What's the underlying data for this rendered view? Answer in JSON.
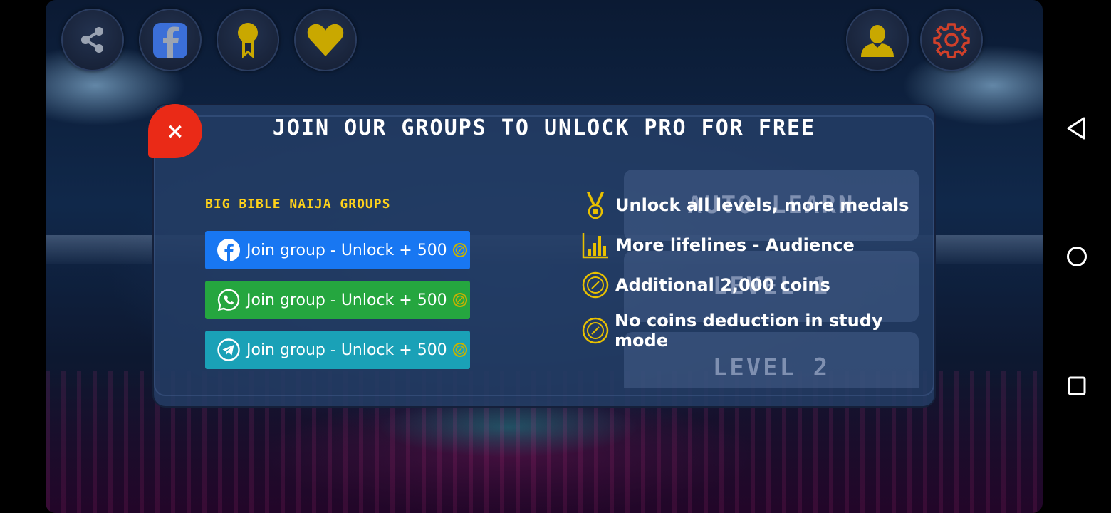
{
  "modal": {
    "title": "JOIN OUR GROUPS TO UNLOCK PRO FOR FREE",
    "close_label": "×",
    "groups_title": "BIG BIBLE NAIJA GROUPS",
    "buttons": [
      {
        "label": "Join group - Unlock + 500",
        "icon": "facebook-icon",
        "color": "#1877f2"
      },
      {
        "label": "Join group - Unlock + 500",
        "icon": "whatsapp-icon",
        "color": "#25a63f"
      },
      {
        "label": "Join group - Unlock + 500",
        "icon": "telegram-icon",
        "color": "#1aa1b7"
      }
    ],
    "features": [
      {
        "text": "Unlock all levels, more medals",
        "icon": "medal-icon"
      },
      {
        "text": "More lifelines - Audience",
        "icon": "bar-chart-icon"
      },
      {
        "text": "Additional 2,000 coins",
        "icon": "coin-icon"
      },
      {
        "text": "No coins deduction in study mode",
        "icon": "coin-icon"
      }
    ]
  },
  "background_levels": [
    "AUTO LEARN",
    "LEVEL 1",
    "LEVEL 2"
  ],
  "top_bar": {
    "left_icons": [
      "share-icon",
      "facebook-icon",
      "award-icon",
      "heart-icon"
    ],
    "right_icons": [
      "profile-icon",
      "settings-icon"
    ]
  },
  "colors": {
    "accent_yellow": "#ffd21a",
    "close_red": "#ea2a17",
    "icon_gold": "#c9a800",
    "settings_red": "#d0402a"
  }
}
